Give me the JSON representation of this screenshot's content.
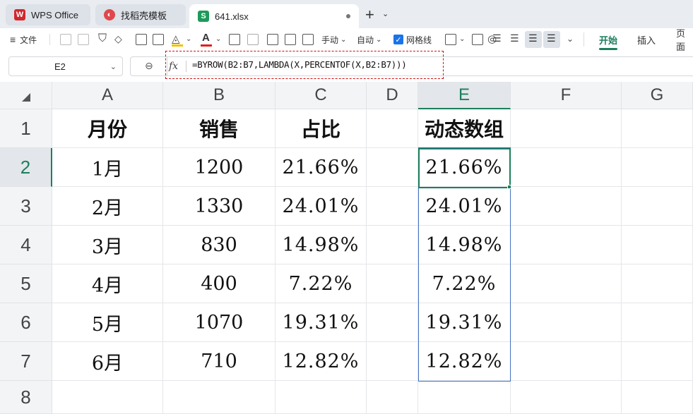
{
  "tabs": [
    {
      "label": "WPS Office",
      "icon": "wps-logo-icon",
      "color": "#d2272d"
    },
    {
      "label": "找稻壳模板",
      "icon": "docer-icon",
      "color": "#e0474c"
    },
    {
      "label": "641.xlsx",
      "icon": "spreadsheet-icon",
      "color": "#1e9a5b"
    }
  ],
  "toolbar": {
    "file_label": "文件",
    "manual_label": "手动",
    "auto_label": "自动",
    "gridlines_label": "网格线",
    "gridlines_checked": true,
    "ribbon_tabs": [
      "开始",
      "插入",
      "页面"
    ],
    "active_ribbon": "开始"
  },
  "formula_bar": {
    "cell_ref": "E2",
    "fx": "fx",
    "formula": "=BYROW(B2:B7,LAMBDA(X,PERCENTOF(X,B2:B7)))"
  },
  "columns": [
    "A",
    "B",
    "C",
    "D",
    "E",
    "F",
    "G"
  ],
  "rows": [
    "1",
    "2",
    "3",
    "4",
    "5",
    "6",
    "7",
    "8"
  ],
  "selected_cell": {
    "column": "E",
    "row": "2"
  },
  "sheet": {
    "headers": {
      "A": "月份",
      "B": "销售",
      "C": "占比",
      "E": "动态数组"
    },
    "data": [
      {
        "A": "1月",
        "B": "1200",
        "C": "21.66%",
        "E": "21.66%"
      },
      {
        "A": "2月",
        "B": "1330",
        "C": "24.01%",
        "E": "24.01%"
      },
      {
        "A": "3月",
        "B": "830",
        "C": "14.98%",
        "E": "14.98%"
      },
      {
        "A": "4月",
        "B": "400",
        "C": "7.22%",
        "E": "7.22%"
      },
      {
        "A": "5月",
        "B": "1070",
        "C": "19.31%",
        "E": "19.31%"
      },
      {
        "A": "6月",
        "B": "710",
        "C": "12.82%",
        "E": "12.82%"
      }
    ]
  },
  "colors": {
    "accent": "#1b7f5c",
    "spill_border": "#4472c4",
    "formula_highlight": "#d01010"
  }
}
